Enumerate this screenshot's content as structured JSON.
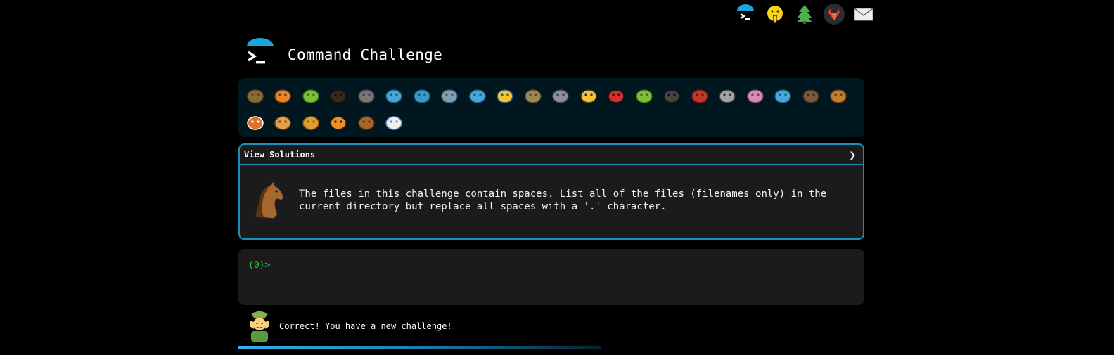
{
  "nav": {
    "icons": [
      "terminal-logo-icon",
      "shushing-face-icon",
      "tree-icon",
      "gitlab-icon",
      "mail-icon"
    ]
  },
  "header": {
    "title": "Command Challenge"
  },
  "animals": {
    "items": [
      "snail-icon",
      "butterfly-icon",
      "caterpillar-icon",
      "ant-icon",
      "spider-web-icon",
      "whale-icon",
      "shark-icon",
      "dolphin-icon",
      "fish-icon",
      "tropical-fish-icon",
      "blowfish-icon",
      "wolf-icon",
      "bee-icon",
      "ladybug-icon",
      "cricket-icon",
      "spider-icon",
      "scorpion-icon",
      "fly-icon",
      "worm-icon",
      "microbe-icon",
      "monkey-icon",
      "dog-icon",
      "fox-icon",
      "cat-icon",
      "lion-icon",
      "tiger-icon",
      "horse-icon",
      "unicorn-icon"
    ]
  },
  "solutions": {
    "toggle_label": "View Solutions",
    "chevron": "❯",
    "description": "The files in this challenge contain spaces. List all of the files (filenames only) in the current directory but replace all spaces with a '.' character."
  },
  "terminal": {
    "prompt": "(0)>"
  },
  "status": {
    "message": "Correct! You have a new challenge!"
  },
  "progress": {
    "fraction": 0.58
  },
  "colors": {
    "accent": "#1c8fb9",
    "prompt": "#1fd43b",
    "panel": "#1b1b1b",
    "animal_bar": "#01171f"
  }
}
